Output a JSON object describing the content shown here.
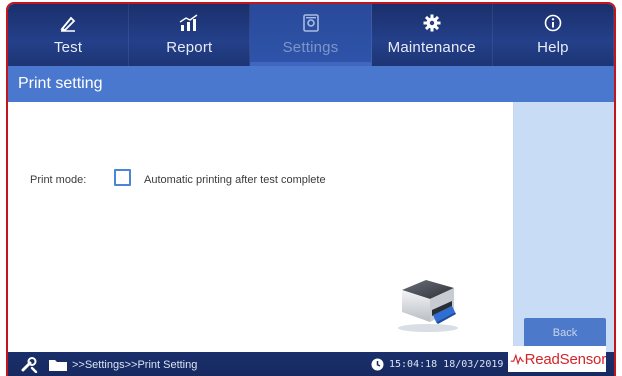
{
  "nav": {
    "tabs": [
      {
        "label": "Test",
        "icon": "pen-icon",
        "active": false
      },
      {
        "label": "Report",
        "icon": "chart-icon",
        "active": false
      },
      {
        "label": "Settings",
        "icon": "settings-icon",
        "active": true
      },
      {
        "label": "Maintenance",
        "icon": "gear-icon",
        "active": false
      },
      {
        "label": "Help",
        "icon": "info-icon",
        "active": false
      }
    ]
  },
  "page": {
    "title": "Print setting"
  },
  "settings": {
    "print_mode_label": "Print mode:",
    "auto_print_label": "Automatic printing after test complete",
    "auto_print_checked": false
  },
  "side": {
    "back_label": "Back"
  },
  "status": {
    "path": ">>Settings>>Print Setting",
    "datetime": "15:04:18 18/03/2019"
  },
  "brand": {
    "name": "ReadSensor"
  },
  "colors": {
    "nav_bg": "#1d3575",
    "header_bg": "#4a78cf",
    "side_panel_bg": "#c9dcf5",
    "frame_border": "#c0161c",
    "checkbox_border": "#4a86d8",
    "brand_red": "#d4252b"
  }
}
